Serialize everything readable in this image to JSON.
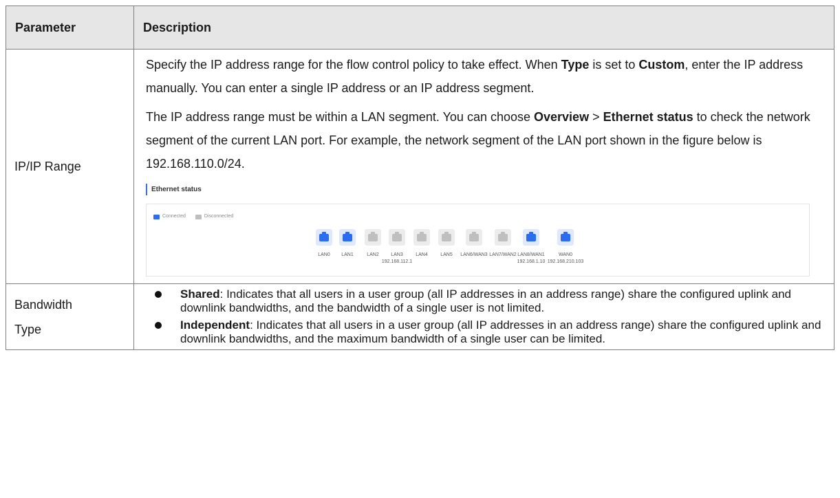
{
  "table": {
    "header": {
      "parameter": "Parameter",
      "description": "Description"
    },
    "row1": {
      "param": "IP/IP Range",
      "p1_a": "Specify the IP address range for the flow control policy to take effect. When ",
      "p1_b": "Type",
      "p1_c": " is set to ",
      "p1_d": "Custom",
      "p1_e": ", enter the IP address manually. You can enter a single IP address or an IP address segment.",
      "p2_a": "The IP address range must be within a LAN segment. You can choose ",
      "p2_b": "Overview",
      "p2_c": " > ",
      "p2_d": "Ethernet status",
      "p2_e": " to check the network segment of the current LAN port. For example, the network segment of the LAN port shown in the figure below is 192.168.110.0/24."
    },
    "row2": {
      "param_line1": "Bandwidth",
      "param_line2": "Type",
      "bullets": [
        {
          "term": "Shared",
          "text": ": Indicates that all users in a user group (all IP addresses in an address range) share the configured uplink and downlink bandwidths, and the bandwidth of a single user is not limited."
        },
        {
          "term": "Independent",
          "text": ": Indicates that all users in a user group (all IP addresses in an address range) share the configured uplink and downlink bandwidths, and the maximum bandwidth of a single user can be limited."
        }
      ]
    }
  },
  "ethernet_status": {
    "title": "Ethernet status",
    "legend_connected": "Connected",
    "legend_disconnected": "Disconnected",
    "colors": {
      "connected": "#2a6df2",
      "disconnected": "#bfbfbf",
      "box_connected": "#dfe9fb",
      "box_disconnected": "#ececec"
    },
    "ports": [
      {
        "name": "LAN0",
        "ip": "",
        "state": "connected"
      },
      {
        "name": "LAN1",
        "ip": "",
        "state": "connected"
      },
      {
        "name": "LAN2",
        "ip": "",
        "state": "disconnected"
      },
      {
        "name": "LAN3",
        "ip": "192.168.112.1",
        "state": "disconnected"
      },
      {
        "name": "LAN4",
        "ip": "",
        "state": "disconnected"
      },
      {
        "name": "LAN5",
        "ip": "",
        "state": "disconnected"
      },
      {
        "name": "LAN6/WAN3",
        "ip": "",
        "state": "disconnected"
      },
      {
        "name": "LAN7/WAN2",
        "ip": "",
        "state": "disconnected"
      },
      {
        "name": "LAN8/WAN1",
        "ip": "192.168.1.10",
        "state": "connected"
      },
      {
        "name": "WAN0",
        "ip": "192.168.210.103",
        "state": "connected"
      }
    ]
  }
}
